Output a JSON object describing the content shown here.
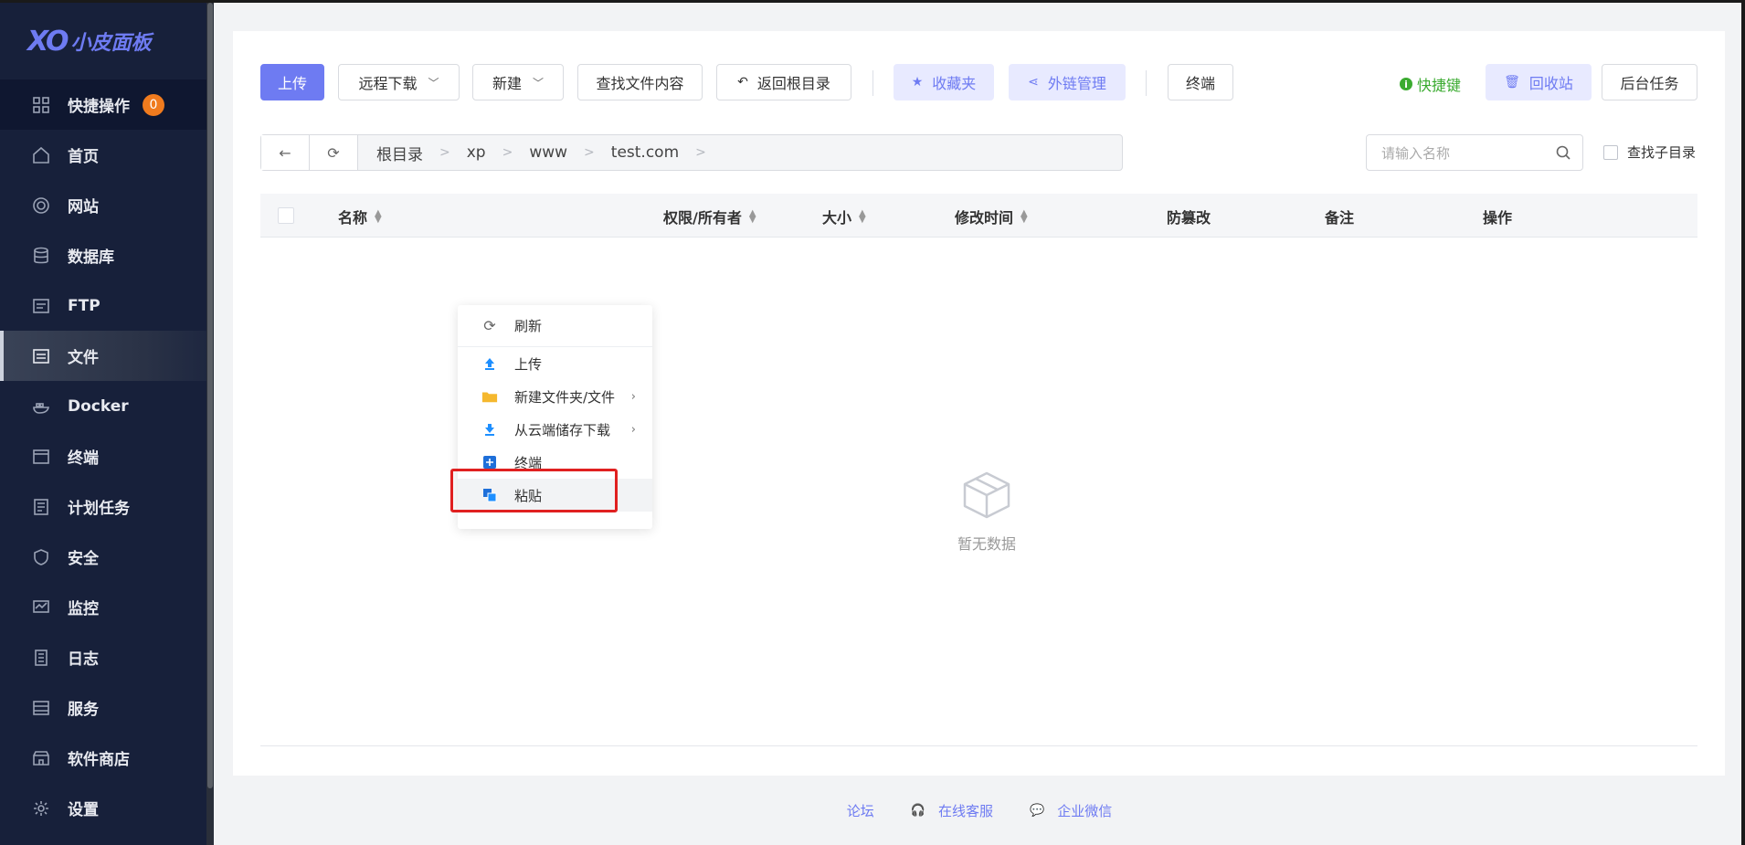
{
  "sidebar": {
    "logo_mark": "XO",
    "logo_text": "小皮面板",
    "quick_label": "快捷操作",
    "quick_badge": "0",
    "items": [
      {
        "label": "首页",
        "icon": "home-icon"
      },
      {
        "label": "网站",
        "icon": "globe-icon"
      },
      {
        "label": "数据库",
        "icon": "database-icon"
      },
      {
        "label": "FTP",
        "icon": "ftp-icon"
      },
      {
        "label": "文件",
        "icon": "file-icon"
      },
      {
        "label": "Docker",
        "icon": "docker-icon"
      },
      {
        "label": "终端",
        "icon": "terminal-icon"
      },
      {
        "label": "计划任务",
        "icon": "task-icon"
      },
      {
        "label": "安全",
        "icon": "shield-icon"
      },
      {
        "label": "监控",
        "icon": "monitor-icon"
      },
      {
        "label": "日志",
        "icon": "log-icon"
      },
      {
        "label": "服务",
        "icon": "server-icon"
      },
      {
        "label": "软件商店",
        "icon": "store-icon"
      },
      {
        "label": "设置",
        "icon": "gear-icon"
      }
    ],
    "active_item": "文件"
  },
  "toolbar": {
    "upload": "上传",
    "remote_download": "远程下载",
    "new": "新建",
    "find_content": "查找文件内容",
    "back_root": "返回根目录",
    "favorites": "收藏夹",
    "share_links": "外链管理",
    "terminal": "终端",
    "shortcut": "快捷键",
    "recycle_bin": "回收站",
    "background_tasks": "后台任务"
  },
  "path": {
    "crumbs": [
      "根目录",
      "xp",
      "www",
      "test.com"
    ],
    "separator": ">"
  },
  "search": {
    "placeholder": "请输入名称",
    "subdir_label": "查找子目录"
  },
  "table": {
    "columns": [
      "名称",
      "权限/所有者",
      "大小",
      "修改时间",
      "防篡改",
      "备注",
      "操作"
    ],
    "empty_text": "暂无数据"
  },
  "context_menu": {
    "items": [
      "刷新",
      "上传",
      "新建文件夹/文件",
      "从云端储存下载",
      "终端",
      "粘贴"
    ],
    "hovered": "粘贴"
  },
  "footer": {
    "forum": "论坛",
    "support": "在线客服",
    "wechat": "企业微信"
  },
  "colors": {
    "accent": "#6e7bf2",
    "sidebar_bg": "#17203a",
    "badge": "#f07b1e",
    "shortcut_green": "#3bab30",
    "highlight_red": "#e02020"
  }
}
